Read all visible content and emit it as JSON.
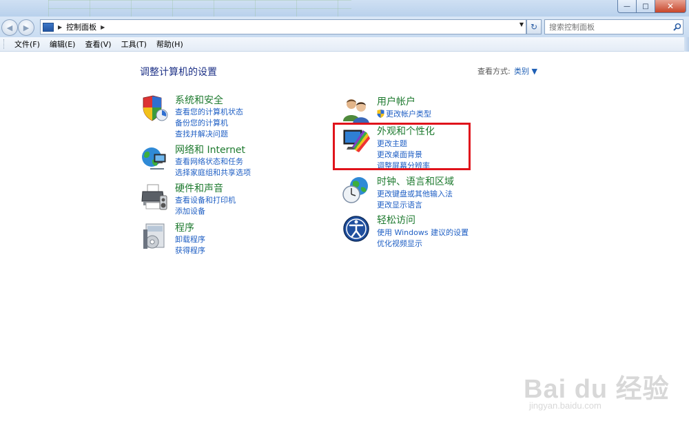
{
  "window": {
    "buttons": {
      "minimize": "—",
      "maximize": "□",
      "close": "✕"
    }
  },
  "nav": {
    "back_icon": "◀",
    "forward_icon": "▶",
    "breadcrumb": "控制面板",
    "breadcrumb_sep": "▶",
    "dropdown_icon": "▼",
    "refresh_icon": "↻",
    "search_placeholder": "搜索控制面板",
    "search_icon": "⚲"
  },
  "menubar": {
    "items": [
      "文件(F)",
      "编辑(E)",
      "查看(V)",
      "工具(T)",
      "帮助(H)"
    ]
  },
  "content": {
    "title": "调整计算机的设置",
    "view_by_label": "查看方式:",
    "view_by_value": "类别 ▼"
  },
  "categories": [
    {
      "title": "系统和安全",
      "links": [
        "查看您的计算机状态",
        "备份您的计算机",
        "查找并解决问题"
      ],
      "icon": "shield-icon"
    },
    {
      "title": "网络和 Internet",
      "links": [
        "查看网络状态和任务",
        "选择家庭组和共享选项"
      ],
      "icon": "network-globe-icon"
    },
    {
      "title": "硬件和声音",
      "links": [
        "查看设备和打印机",
        "添加设备"
      ],
      "icon": "printer-icon"
    },
    {
      "title": "程序",
      "links": [
        "卸载程序",
        "获得程序"
      ],
      "icon": "programs-icon"
    },
    {
      "title": "用户帐户",
      "links": [
        "更改帐户类型"
      ],
      "icon": "users-icon"
    },
    {
      "title": "外观和个性化",
      "links": [
        "更改主题",
        "更改桌面背景",
        "调整屏幕分辨率"
      ],
      "icon": "monitor-palette-icon"
    },
    {
      "title": "时钟、语言和区域",
      "links": [
        "更改键盘或其他输入法",
        "更改显示语言"
      ],
      "icon": "clock-globe-icon"
    },
    {
      "title": "轻松访问",
      "links": [
        "使用 Windows 建议的设置",
        "优化视频显示"
      ],
      "icon": "ease-of-access-icon"
    }
  ],
  "highlight_color": "#e0131b",
  "watermark": {
    "logo": "Bai du 经验",
    "url": "jingyan.baidu.com"
  }
}
